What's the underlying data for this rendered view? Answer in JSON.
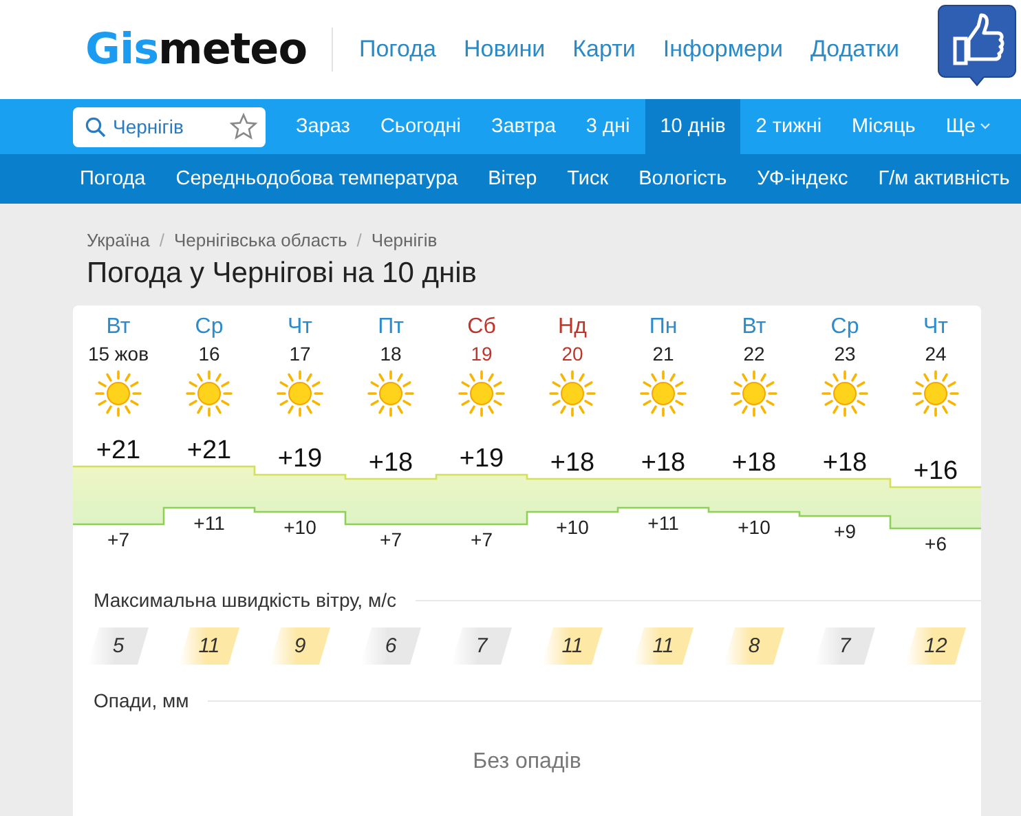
{
  "header": {
    "logo": {
      "part_1": "Gis",
      "part_2": "meteo"
    },
    "nav": [
      "Погода",
      "Новини",
      "Карти",
      "Інформери",
      "Додатки"
    ]
  },
  "search": {
    "value": "Чернігів"
  },
  "tabs": [
    {
      "label": "Зараз",
      "selected": false
    },
    {
      "label": "Сьогодні",
      "selected": false
    },
    {
      "label": "Завтра",
      "selected": false
    },
    {
      "label": "3 дні",
      "selected": false
    },
    {
      "label": "10 днів",
      "selected": true
    },
    {
      "label": "2 тижні",
      "selected": false
    },
    {
      "label": "Місяць",
      "selected": false
    },
    {
      "label": "Ще",
      "selected": false
    }
  ],
  "subnav": [
    "Погода",
    "Середньодобова температура",
    "Вітер",
    "Тиск",
    "Вологість",
    "УФ-індекс",
    "Г/м активність"
  ],
  "breadcrumbs": [
    "Україна",
    "/",
    "Чернігівська область",
    "/",
    "Чернігів"
  ],
  "title": "Погода у Чернігові на 10 днів",
  "days": [
    {
      "name": "Вт",
      "date": "15 жов",
      "weekend": false,
      "max": "+21",
      "min": "+7",
      "wind": "5",
      "strong_wind": false
    },
    {
      "name": "Ср",
      "date": "16",
      "weekend": false,
      "max": "+21",
      "min": "+11",
      "wind": "11",
      "strong_wind": true
    },
    {
      "name": "Чт",
      "date": "17",
      "weekend": false,
      "max": "+19",
      "min": "+10",
      "wind": "9",
      "strong_wind": true
    },
    {
      "name": "Пт",
      "date": "18",
      "weekend": false,
      "max": "+18",
      "min": "+7",
      "wind": "6",
      "strong_wind": false
    },
    {
      "name": "Сб",
      "date": "19",
      "weekend": true,
      "max": "+19",
      "min": "+7",
      "wind": "7",
      "strong_wind": false
    },
    {
      "name": "Нд",
      "date": "20",
      "weekend": true,
      "max": "+18",
      "min": "+10",
      "wind": "11",
      "strong_wind": true
    },
    {
      "name": "Пн",
      "date": "21",
      "weekend": false,
      "max": "+18",
      "min": "+11",
      "wind": "11",
      "strong_wind": true
    },
    {
      "name": "Вт",
      "date": "22",
      "weekend": false,
      "max": "+18",
      "min": "+10",
      "wind": "8",
      "strong_wind": true
    },
    {
      "name": "Ср",
      "date": "23",
      "weekend": false,
      "max": "+18",
      "min": "+9",
      "wind": "7",
      "strong_wind": false
    },
    {
      "name": "Чт",
      "date": "24",
      "weekend": false,
      "max": "+16",
      "min": "+6",
      "wind": "12",
      "strong_wind": true
    }
  ],
  "wind_label": "Максимальна швидкість вітру, м/с",
  "precip_label": "Опади, мм",
  "precip_text": "Без опадів"
}
